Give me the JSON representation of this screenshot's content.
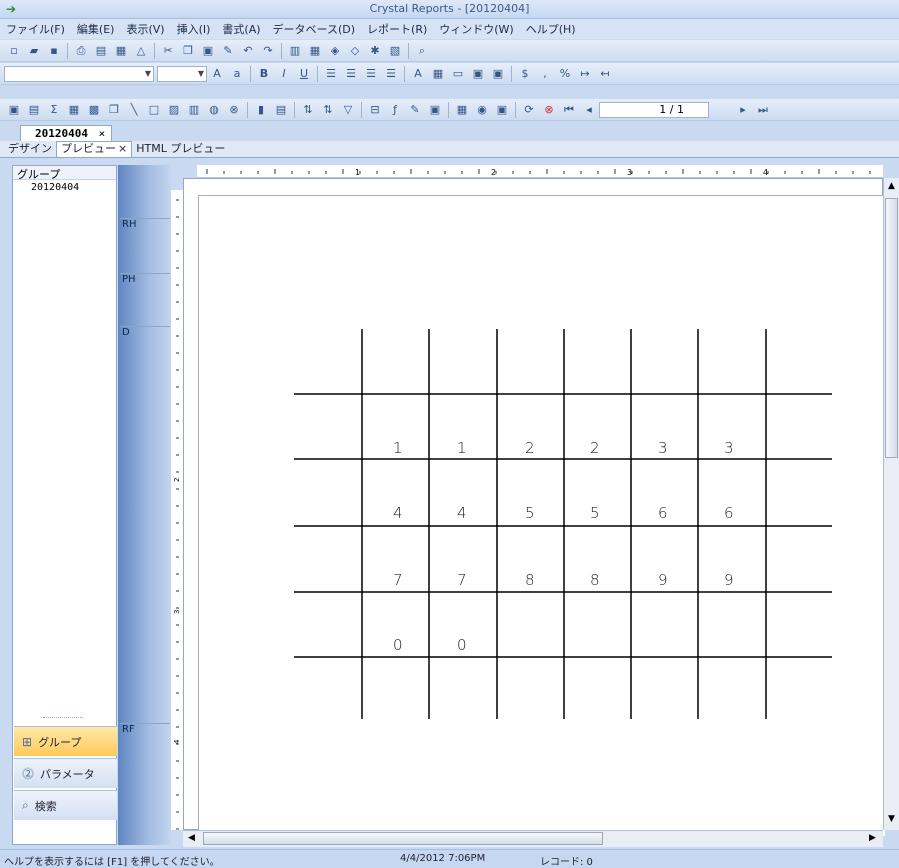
{
  "window": {
    "title": "Crystal Reports - [20120404]"
  },
  "menu": [
    "ファイル(F)",
    "編集(E)",
    "表示(V)",
    "挿入(I)",
    "書式(A)",
    "データベース(D)",
    "レポート(R)",
    "ウィンドウ(W)",
    "ヘルプ(H)"
  ],
  "toolbar": {
    "page_indicator": "1 / 1"
  },
  "doc_tab": {
    "label": "20120404",
    "close": "×"
  },
  "view_tabs": [
    "デザイン",
    "プレビュー",
    "HTML プレビュー"
  ],
  "left_pane": {
    "header": "グループ",
    "tree_item": "20120404",
    "nav": [
      {
        "label": "グループ",
        "icon": "group-tree-icon"
      },
      {
        "label": "パラメータ",
        "icon": "parameter-icon"
      },
      {
        "label": "検索",
        "icon": "search-icon"
      }
    ]
  },
  "bands": [
    "RH",
    "PH",
    "D",
    "RF"
  ],
  "ruler": {
    "h_numbers": [
      "1",
      "2",
      "3",
      "4"
    ],
    "v_numbers": [
      "2",
      "3",
      "4"
    ]
  },
  "report_grid": {
    "rows": [
      [
        "1",
        "1",
        "2",
        "2",
        "3",
        "3"
      ],
      [
        "4",
        "4",
        "5",
        "5",
        "6",
        "6"
      ],
      [
        "7",
        "7",
        "8",
        "8",
        "9",
        "9"
      ],
      [
        "0",
        "0",
        "",
        "",
        "",
        ""
      ]
    ]
  },
  "status": {
    "help": "ヘルプを表示するには [F1] を押してください。",
    "datetime": "4/4/2012  7:06PM",
    "records": "レコード: 0"
  }
}
